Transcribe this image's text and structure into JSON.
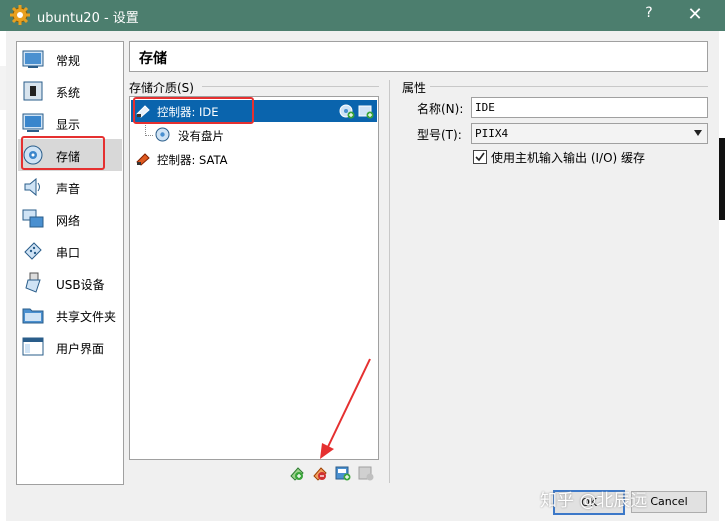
{
  "window": {
    "title": "ubuntu20 - 设置",
    "help": "?",
    "close": "✕"
  },
  "sidebar": {
    "items": [
      {
        "label": "常规"
      },
      {
        "label": "系统"
      },
      {
        "label": "显示"
      },
      {
        "label": "存储"
      },
      {
        "label": "声音"
      },
      {
        "label": "网络"
      },
      {
        "label": "串口"
      },
      {
        "label": "USB设备"
      },
      {
        "label": "共享文件夹"
      },
      {
        "label": "用户界面"
      }
    ],
    "selected": "存储"
  },
  "page": {
    "title": "存储"
  },
  "storage": {
    "group_label": "存储介质(S)",
    "tree": [
      {
        "label": "控制器: IDE"
      },
      {
        "label": "没有盘片"
      },
      {
        "label": "控制器: SATA"
      }
    ]
  },
  "attributes": {
    "group_label": "属性",
    "name_label": "名称(N):",
    "name_value": "IDE",
    "type_label": "型号(T):",
    "type_value": "PIIX4",
    "host_io_label": "使用主机输入输出 (I/O) 缓存",
    "host_io_checked": true
  },
  "buttons": {
    "ok": "OK",
    "cancel": "Cancel"
  },
  "watermark": "知乎 @北辰远"
}
